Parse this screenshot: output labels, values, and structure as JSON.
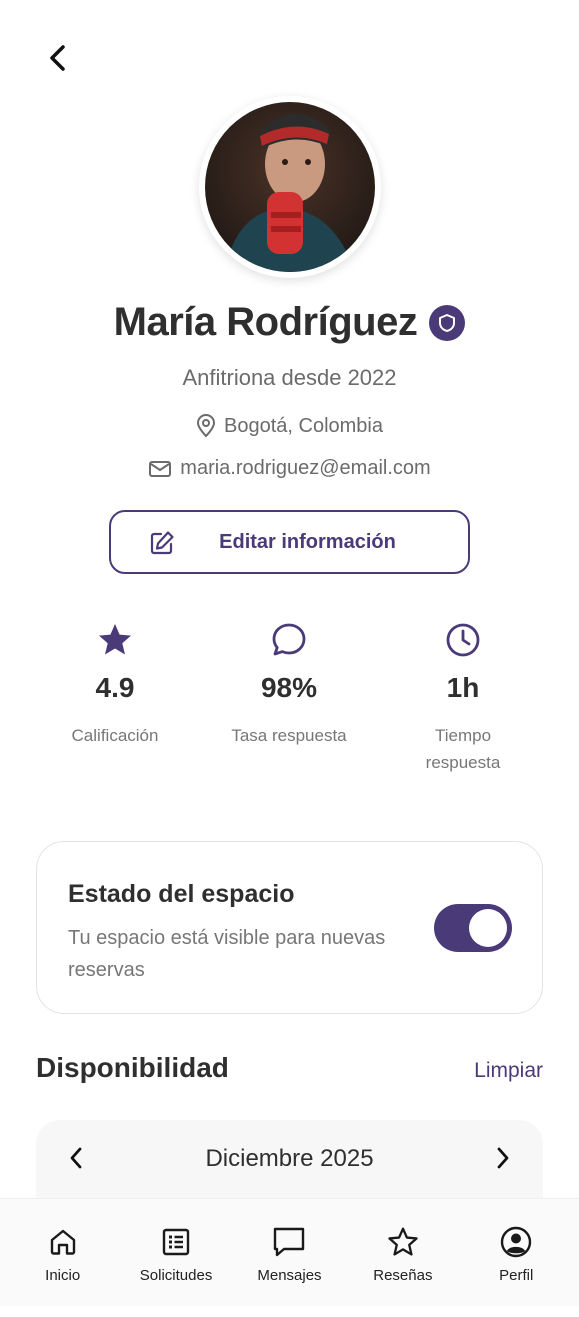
{
  "profile": {
    "name": "María Rodríguez",
    "since": "Anfitriona desde 2022",
    "location": "Bogotá, Colombia",
    "email": "maria.rodriguez@email.com",
    "edit_label": "Editar información"
  },
  "stats": [
    {
      "icon": "star-icon",
      "value": "4.9",
      "label": "Calificación"
    },
    {
      "icon": "chat-bubble-icon",
      "value": "98%",
      "label": "Tasa respuesta"
    },
    {
      "icon": "clock-icon",
      "value": "1h",
      "label": "Tiempo respuesta"
    }
  ],
  "status": {
    "title": "Estado del espacio",
    "description": "Tu espacio está visible para nuevas reservas",
    "enabled": true
  },
  "availability": {
    "title": "Disponibilidad",
    "clear_label": "Limpiar",
    "month": "Diciembre 2025"
  },
  "nav": {
    "items": [
      {
        "label": "Inicio",
        "icon": "home-icon"
      },
      {
        "label": "Solicitudes",
        "icon": "list-icon"
      },
      {
        "label": "Mensajes",
        "icon": "message-icon"
      },
      {
        "label": "Reseñas",
        "icon": "star-outline-icon"
      },
      {
        "label": "Perfil",
        "icon": "user-icon"
      }
    ]
  },
  "colors": {
    "accent": "#4b3a78",
    "text": "#2f2f2f",
    "muted": "#777777"
  }
}
